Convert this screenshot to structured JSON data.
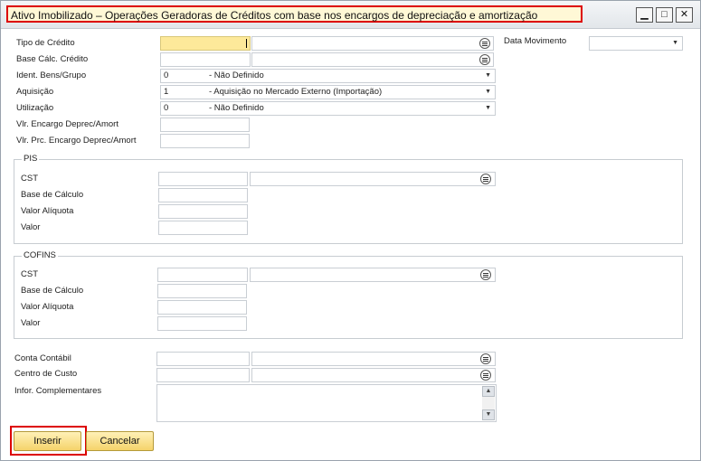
{
  "window": {
    "title": "Ativo Imobilizado – Operações Geradoras de Créditos com base nos encargos de depreciação e amortização",
    "controls": {
      "minimize": "▁",
      "maximize": "□",
      "close": "✕"
    }
  },
  "form": {
    "tipo_credito": {
      "label": "Tipo de Crédito",
      "value": ""
    },
    "base_calc_credito": {
      "label": "Base Cálc. Crédito",
      "value": ""
    },
    "ident_bens": {
      "label": "Ident. Bens/Grupo",
      "code": "0",
      "desc": "- Não Definido"
    },
    "aquisicao": {
      "label": "Aquisição",
      "code": "1",
      "desc": "- Aquisição no Mercado Externo (Importação)"
    },
    "utilizacao": {
      "label": "Utilização",
      "code": "0",
      "desc": "- Não Definido"
    },
    "vlr_encargo": {
      "label": "Vlr. Encargo Deprec/Amort",
      "value": ""
    },
    "vlr_prc_encargo": {
      "label": "Vlr. Prc. Encargo Deprec/Amort",
      "value": ""
    },
    "data_movimento": {
      "label": "Data Movimento",
      "value": ""
    }
  },
  "pis": {
    "title": "PIS",
    "cst": "CST",
    "base_calculo": "Base de Cálculo",
    "valor_aliquota": "Valor Alíquota",
    "valor": "Valor"
  },
  "cofins": {
    "title": "COFINS",
    "cst": "CST",
    "base_calculo": "Base de Cálculo",
    "valor_aliquota": "Valor Alíquota",
    "valor": "Valor"
  },
  "footer_fields": {
    "conta_contabil": "Conta Contábil",
    "centro_custo": "Centro de Custo",
    "infor_complementares": "Infor. Complementares"
  },
  "buttons": {
    "inserir": "Inserir",
    "cancelar": "Cancelar"
  },
  "icons": {
    "dropdown": "▼",
    "scroll_up": "▲",
    "scroll_down": "▼"
  }
}
